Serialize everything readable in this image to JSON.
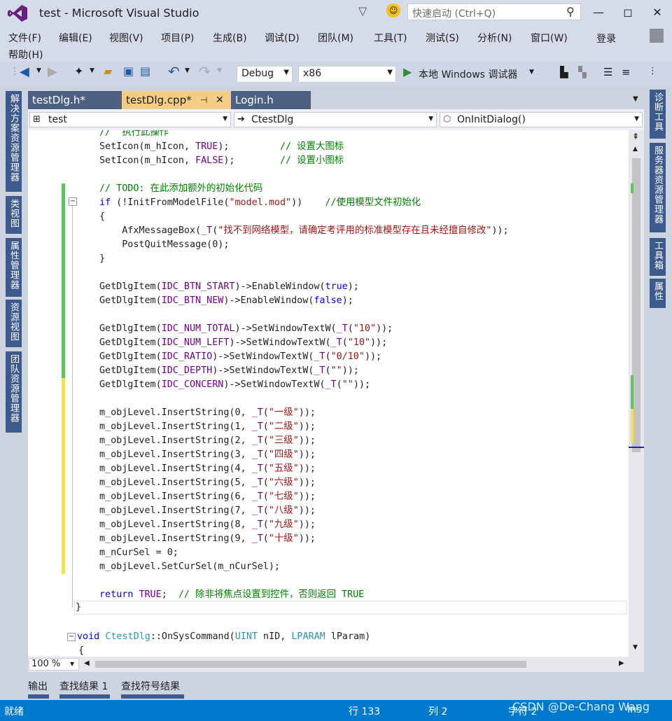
{
  "window": {
    "title": "test - Microsoft Visual Studio",
    "quick_launch_placeholder": "快速启动 (Ctrl+Q)",
    "login": "登录"
  },
  "menu": {
    "items": [
      "文件(F)",
      "编辑(E)",
      "视图(V)",
      "项目(P)",
      "生成(B)",
      "调试(D)",
      "团队(M)",
      "工具(T)",
      "测试(S)",
      "分析(N)",
      "窗口(W)"
    ],
    "help": "帮助(H)"
  },
  "toolbar": {
    "config": "Debug",
    "platform": "x86",
    "debugger": "本地 Windows 调试器"
  },
  "left_panels": [
    "解决方案资源管理器",
    "类视图",
    "属性管理器",
    "资源视图",
    "团队资源管理器"
  ],
  "right_panels": [
    "诊断工具",
    "服务器资源管理器",
    "工具箱",
    "属性"
  ],
  "tabs": [
    {
      "label": "testDlg.h*"
    },
    {
      "label": "testDlg.cpp*"
    },
    {
      "label": "Login.h"
    }
  ],
  "nav": {
    "project": "test",
    "class": "CtestDlg",
    "member": "OnInitDialog()"
  },
  "code": {
    "l1": "//  执行此操作",
    "l2a": "SetIcon(m_hIcon, ",
    "l2b": "TRUE",
    "l2c": ");         ",
    "l2d": "// 设置大图标",
    "l3a": "SetIcon(m_hIcon, ",
    "l3b": "FALSE",
    "l3c": ");        ",
    "l3d": "// 设置小图标",
    "l5": "// TODO: 在此添加额外的初始化代码",
    "l6a": "if",
    "l6b": " (!InitFromModelFile(",
    "l6c": "\"model.mod\"",
    "l6d": "))    ",
    "l6e": "//使用模型文件初始化",
    "l7": "{",
    "l8a": "    AfxMessageBox(",
    "l8b": "_T",
    "l8c": "(",
    "l8d": "\"找不到网络模型，请确定考评用的标准模型存在且未经擅自修改\"",
    "l8e": "));",
    "l9": "    PostQuitMessage(0);",
    "l10": "}",
    "l12a": "GetDlgItem(",
    "l12b": "IDC_BTN_START",
    "l12c": ")->EnableWindow(",
    "l12d": "true",
    "l12e": ");",
    "l13a": "GetDlgItem(",
    "l13b": "IDC_BTN_NEW",
    "l13c": ")->EnableWindow(",
    "l13d": "false",
    "l13e": ");",
    "l15a": "GetDlgItem(",
    "l15b": "IDC_NUM_TOTAL",
    "l15c": ")->SetWindowTextW(",
    "l15d": "_T",
    "l15e": "(",
    "l15f": "\"10\"",
    "l15g": "));",
    "l16a": "GetDlgItem(",
    "l16b": "IDC_NUM_LEFT",
    "l16c": ")->SetWindowTextW(",
    "l16d": "_T",
    "l16e": "(",
    "l16f": "\"10\"",
    "l16g": "));",
    "l17a": "GetDlgItem(",
    "l17b": "IDC_RATIO",
    "l17c": ")->SetWindowTextW(",
    "l17d": "_T",
    "l17e": "(",
    "l17f": "\"0/10\"",
    "l17g": "));",
    "l18a": "GetDlgItem(",
    "l18b": "IDC_DEPTH",
    "l18c": ")->SetWindowTextW(",
    "l18d": "_T",
    "l18e": "(",
    "l18f": "\"\"",
    "l18g": "));",
    "l19a": "GetDlgItem(",
    "l19b": "IDC_CONCERN",
    "l19c": ")->SetWindowTextW(",
    "l19d": "_T",
    "l19e": "(",
    "l19f": "\"\"",
    "l19g": "));",
    "levels": [
      {
        "a": "m_objLevel.InsertString(0, ",
        "b": "_T",
        "c": "(",
        "d": "\"一级\"",
        "e": "));"
      },
      {
        "a": "m_objLevel.InsertString(1, ",
        "b": "_T",
        "c": "(",
        "d": "\"二级\"",
        "e": "));"
      },
      {
        "a": "m_objLevel.InsertString(2, ",
        "b": "_T",
        "c": "(",
        "d": "\"三级\"",
        "e": "));"
      },
      {
        "a": "m_objLevel.InsertString(3, ",
        "b": "_T",
        "c": "(",
        "d": "\"四级\"",
        "e": "));"
      },
      {
        "a": "m_objLevel.InsertString(4, ",
        "b": "_T",
        "c": "(",
        "d": "\"五级\"",
        "e": "));"
      },
      {
        "a": "m_objLevel.InsertString(5, ",
        "b": "_T",
        "c": "(",
        "d": "\"六级\"",
        "e": "));"
      },
      {
        "a": "m_objLevel.InsertString(6, ",
        "b": "_T",
        "c": "(",
        "d": "\"七级\"",
        "e": "));"
      },
      {
        "a": "m_objLevel.InsertString(7, ",
        "b": "_T",
        "c": "(",
        "d": "\"八级\"",
        "e": "));"
      },
      {
        "a": "m_objLevel.InsertString(8, ",
        "b": "_T",
        "c": "(",
        "d": "\"九级\"",
        "e": "));"
      },
      {
        "a": "m_objLevel.InsertString(9, ",
        "b": "_T",
        "c": "(",
        "d": "\"十级\"",
        "e": "));"
      }
    ],
    "l31": "m_nCurSel = 0;",
    "l32": "m_objLevel.SetCurSel(m_nCurSel);",
    "l34a": "return",
    "l34b": " ",
    "l34c": "TRUE",
    "l34d": ";  ",
    "l34e": "// 除非将焦点设置到控件，否则返回 TRUE",
    "l35": "}",
    "l37a": "void",
    "l37b": " ",
    "l37c": "CtestDlg",
    "l37d": "::OnSysCommand(",
    "l37e": "UINT",
    "l37f": " nID, ",
    "l37g": "LPARAM",
    "l37h": " lParam)",
    "l38": "{"
  },
  "zoom": "100 %",
  "output_tabs": [
    "输出",
    "查找结果 1",
    "查找符号结果"
  ],
  "status": {
    "ready": "就绪",
    "line": "行 133",
    "col": "列 2",
    "char": "字符 2",
    "ins": "Ins",
    "watermark": "CSDN @De-Chang Wang"
  }
}
